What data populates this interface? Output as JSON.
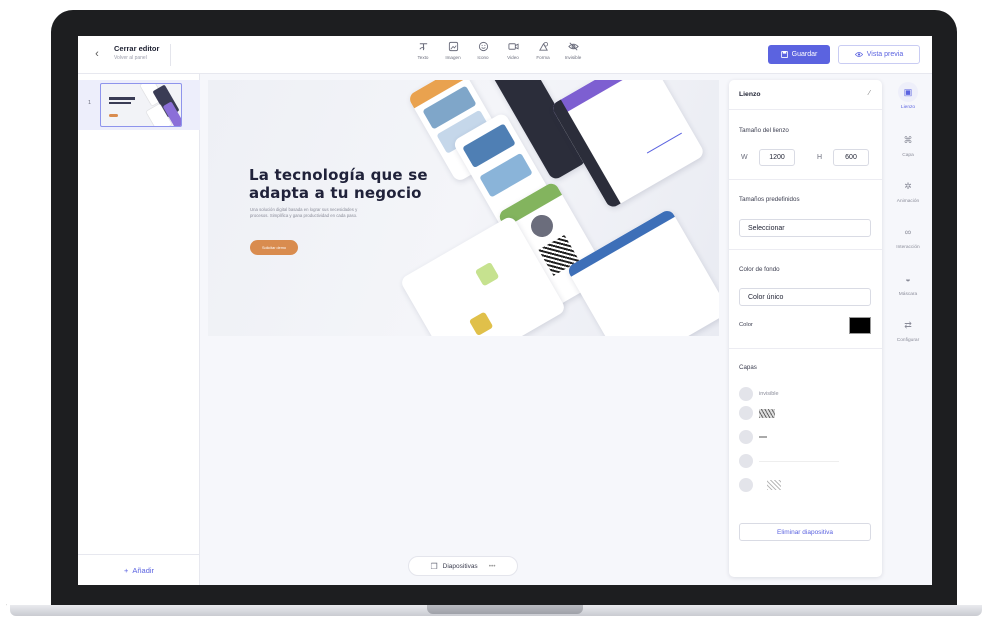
{
  "header": {
    "close_title": "Cerrar editor",
    "close_subtitle": "Volver al panel",
    "tools": [
      {
        "label": "Texto",
        "icon": "text-icon"
      },
      {
        "label": "Imagen",
        "icon": "image-icon"
      },
      {
        "label": "Icono",
        "icon": "smiley-icon"
      },
      {
        "label": "Video",
        "icon": "video-icon"
      },
      {
        "label": "Forma",
        "icon": "shape-icon"
      },
      {
        "label": "Invisible",
        "icon": "eye-off-icon"
      }
    ],
    "save_label": "Guardar",
    "preview_label": "Vista previa"
  },
  "slides": {
    "items": [
      {
        "number": "1"
      }
    ],
    "add_label": "Añadir"
  },
  "canvas": {
    "title": "La tecnología que se adapta a tu negocio",
    "subtitle": "Una solución digital basada en lograr sus necesidades y procesos. Simplifica y gana productividad en cada paso.",
    "cta_label": "Solicitar demo"
  },
  "bottom_bar": {
    "label": "Diapositivas",
    "more": "•••"
  },
  "panel": {
    "title": "Lienzo",
    "canvas_size_label": "Tamaño del lienzo",
    "width_label": "W",
    "width_value": "1200",
    "height_label": "H",
    "height_value": "600",
    "presets_label": "Tamaños predefinidos",
    "presets_value": "Seleccionar",
    "bg_label": "Color de fondo",
    "bg_value": "Color único",
    "color_label": "Color",
    "color_value": "#000000",
    "layers_label": "Capas",
    "layers": [
      {
        "name": "invisible"
      },
      {
        "name": ""
      },
      {
        "name": ""
      },
      {
        "name": ""
      },
      {
        "name": ""
      }
    ],
    "delete_label": "Eliminar diapositiva"
  },
  "rail": [
    {
      "label": "Lienzo",
      "icon": "canvas-icon"
    },
    {
      "label": "Capa",
      "icon": "layer-icon"
    },
    {
      "label": "Animación",
      "icon": "animation-icon"
    },
    {
      "label": "Interacción",
      "icon": "link-icon"
    },
    {
      "label": "Máscara",
      "icon": "mask-icon"
    },
    {
      "label": "Configurar",
      "icon": "settings-icon"
    }
  ],
  "colors": {
    "accent": "#5b63e0",
    "cta": "#d98c4f",
    "frame": "#1d1e20"
  }
}
